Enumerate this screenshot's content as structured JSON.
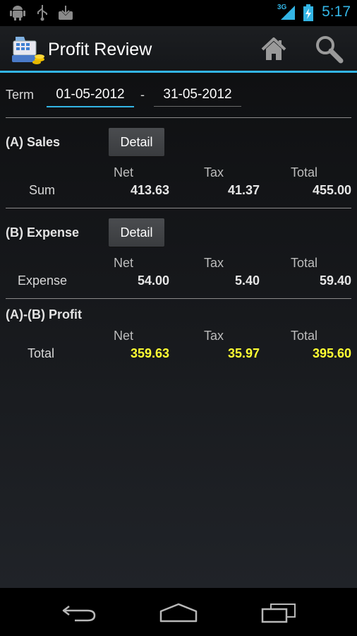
{
  "status_bar": {
    "time": "5:17",
    "network": "3G"
  },
  "app": {
    "title": "Profit Review"
  },
  "term": {
    "label": "Term",
    "from": "01-05-2012",
    "separator": "-",
    "to": "31-05-2012"
  },
  "columns": {
    "net": "Net",
    "tax": "Tax",
    "total": "Total"
  },
  "sales": {
    "title": "(A) Sales",
    "detail_label": "Detail",
    "row_label": "Sum",
    "net": "413.63",
    "tax": "41.37",
    "total": "455.00"
  },
  "expense": {
    "title": "(B) Expense",
    "detail_label": "Detail",
    "row_label": "Expense",
    "net": "54.00",
    "tax": "5.40",
    "total": "59.40"
  },
  "profit": {
    "title": "(A)-(B) Profit",
    "row_label": "Total",
    "net": "359.63",
    "tax": "35.97",
    "total": "395.60"
  },
  "colors": {
    "accent": "#33b5e5",
    "highlight": "#ffff33"
  }
}
